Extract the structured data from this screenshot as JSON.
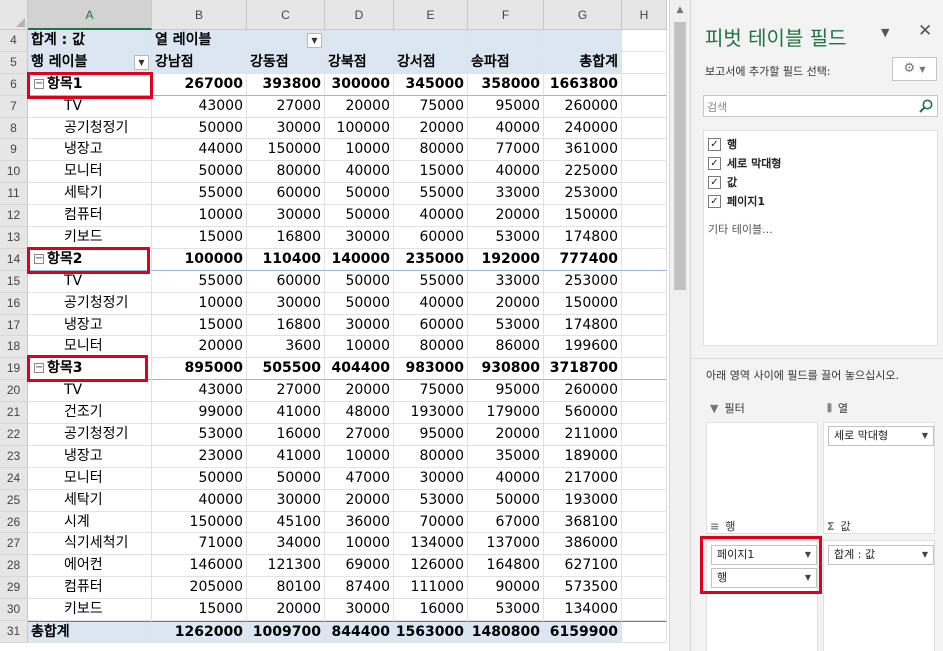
{
  "spreadsheet": {
    "columns": [
      "A",
      "B",
      "C",
      "D",
      "E",
      "F",
      "G",
      "H"
    ],
    "selected_column": "A",
    "header": {
      "row4": {
        "rownum": "4",
        "a": "합계 : 값",
        "b": "열 레이블"
      },
      "row5": {
        "rownum": "5",
        "a": "행 레이블",
        "cols": [
          "강남점",
          "강동점",
          "강북점",
          "강서점",
          "송파점",
          "총합계"
        ]
      }
    },
    "rows": [
      {
        "rownum": "6",
        "type": "group",
        "label": "항목1",
        "values": [
          "267000",
          "393800",
          "300000",
          "345000",
          "358000",
          "1663800"
        ]
      },
      {
        "rownum": "7",
        "type": "item",
        "label": "TV",
        "values": [
          "43000",
          "27000",
          "20000",
          "75000",
          "95000",
          "260000"
        ]
      },
      {
        "rownum": "8",
        "type": "item",
        "label": "공기청정기",
        "values": [
          "50000",
          "30000",
          "100000",
          "20000",
          "40000",
          "240000"
        ]
      },
      {
        "rownum": "9",
        "type": "item",
        "label": "냉장고",
        "values": [
          "44000",
          "150000",
          "10000",
          "80000",
          "77000",
          "361000"
        ]
      },
      {
        "rownum": "10",
        "type": "item",
        "label": "모니터",
        "values": [
          "50000",
          "80000",
          "40000",
          "15000",
          "40000",
          "225000"
        ]
      },
      {
        "rownum": "11",
        "type": "item",
        "label": "세탁기",
        "values": [
          "55000",
          "60000",
          "50000",
          "55000",
          "33000",
          "253000"
        ]
      },
      {
        "rownum": "12",
        "type": "item",
        "label": "컴퓨터",
        "values": [
          "10000",
          "30000",
          "50000",
          "40000",
          "20000",
          "150000"
        ]
      },
      {
        "rownum": "13",
        "type": "item",
        "label": "키보드",
        "values": [
          "15000",
          "16800",
          "30000",
          "60000",
          "53000",
          "174800"
        ]
      },
      {
        "rownum": "14",
        "type": "group",
        "label": "항목2",
        "values": [
          "100000",
          "110400",
          "140000",
          "235000",
          "192000",
          "777400"
        ]
      },
      {
        "rownum": "15",
        "type": "item",
        "label": "TV",
        "values": [
          "55000",
          "60000",
          "50000",
          "55000",
          "33000",
          "253000"
        ]
      },
      {
        "rownum": "16",
        "type": "item",
        "label": "공기청정기",
        "values": [
          "10000",
          "30000",
          "50000",
          "40000",
          "20000",
          "150000"
        ]
      },
      {
        "rownum": "17",
        "type": "item",
        "label": "냉장고",
        "values": [
          "15000",
          "16800",
          "30000",
          "60000",
          "53000",
          "174800"
        ]
      },
      {
        "rownum": "18",
        "type": "item",
        "label": "모니터",
        "values": [
          "20000",
          "3600",
          "10000",
          "80000",
          "86000",
          "199600"
        ]
      },
      {
        "rownum": "19",
        "type": "group",
        "label": "항목3",
        "values": [
          "895000",
          "505500",
          "404400",
          "983000",
          "930800",
          "3718700"
        ]
      },
      {
        "rownum": "20",
        "type": "item",
        "label": "TV",
        "values": [
          "43000",
          "27000",
          "20000",
          "75000",
          "95000",
          "260000"
        ]
      },
      {
        "rownum": "21",
        "type": "item",
        "label": "건조기",
        "values": [
          "99000",
          "41000",
          "48000",
          "193000",
          "179000",
          "560000"
        ]
      },
      {
        "rownum": "22",
        "type": "item",
        "label": "공기청정기",
        "values": [
          "53000",
          "16000",
          "27000",
          "95000",
          "20000",
          "211000"
        ]
      },
      {
        "rownum": "23",
        "type": "item",
        "label": "냉장고",
        "values": [
          "23000",
          "41000",
          "10000",
          "80000",
          "35000",
          "189000"
        ]
      },
      {
        "rownum": "24",
        "type": "item",
        "label": "모니터",
        "values": [
          "50000",
          "50000",
          "47000",
          "30000",
          "40000",
          "217000"
        ]
      },
      {
        "rownum": "25",
        "type": "item",
        "label": "세탁기",
        "values": [
          "40000",
          "30000",
          "20000",
          "53000",
          "50000",
          "193000"
        ]
      },
      {
        "rownum": "26",
        "type": "item",
        "label": "시계",
        "values": [
          "150000",
          "45100",
          "36000",
          "70000",
          "67000",
          "368100"
        ]
      },
      {
        "rownum": "27",
        "type": "item",
        "label": "식기세척기",
        "values": [
          "71000",
          "34000",
          "10000",
          "134000",
          "137000",
          "386000"
        ]
      },
      {
        "rownum": "28",
        "type": "item",
        "label": "에어컨",
        "values": [
          "146000",
          "121300",
          "69000",
          "126000",
          "164800",
          "627100"
        ]
      },
      {
        "rownum": "29",
        "type": "item",
        "label": "컴퓨터",
        "values": [
          "205000",
          "80100",
          "87400",
          "111000",
          "90000",
          "573500"
        ]
      },
      {
        "rownum": "30",
        "type": "item",
        "label": "키보드",
        "values": [
          "15000",
          "20000",
          "30000",
          "16000",
          "53000",
          "134000"
        ]
      },
      {
        "rownum": "31",
        "type": "total",
        "label": "총합계",
        "values": [
          "1262000",
          "1009700",
          "844400",
          "1563000",
          "1480800",
          "6159900"
        ]
      }
    ]
  },
  "pivot_pane": {
    "title": "피벗 테이블 필드",
    "subtitle": "보고서에 추가할 필드 선택:",
    "search_placeholder": "검색",
    "fields": [
      {
        "label": "행",
        "checked": true
      },
      {
        "label": "세로 막대형",
        "checked": true
      },
      {
        "label": "값",
        "checked": true
      },
      {
        "label": "페이지1",
        "checked": true
      }
    ],
    "more_tables": "기타 테이블...",
    "drag_hint": "아래 영역 사이에 필드를 끌어 놓으십시오.",
    "areas": {
      "filter": {
        "label": "필터",
        "items": []
      },
      "columns": {
        "label": "열",
        "items": [
          "세로 막대형"
        ]
      },
      "rows": {
        "label": "행",
        "items": [
          "페이지1",
          "행"
        ]
      },
      "values": {
        "label": "값",
        "items": [
          "합계 : 값"
        ]
      }
    }
  },
  "colors": {
    "accent": "#217346",
    "pivot_header_fill": "#dce6f2",
    "highlight_box": "#e0001b"
  }
}
